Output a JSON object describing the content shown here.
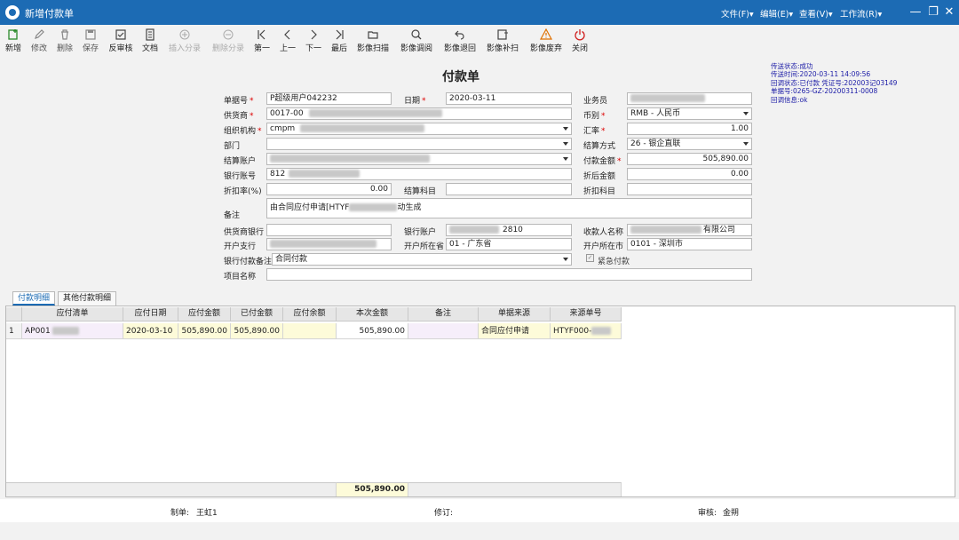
{
  "window": {
    "title": "新增付款单",
    "menus": [
      "文件(F)▾",
      "编辑(E)▾",
      "查看(V)▾",
      "工作流(R)▾"
    ]
  },
  "toolbar": [
    {
      "label": "新增",
      "icon": "new-doc-icon",
      "enabled": true
    },
    {
      "label": "修改",
      "icon": "edit-icon",
      "enabled": false
    },
    {
      "label": "删除",
      "icon": "trash-icon",
      "enabled": false
    },
    {
      "label": "保存",
      "icon": "save-icon",
      "enabled": false
    },
    {
      "label": "反审核",
      "icon": "unaudit-icon",
      "enabled": true
    },
    {
      "label": "文档",
      "icon": "document-icon",
      "enabled": true
    },
    {
      "label": "插入分录",
      "icon": "plus-circle-icon",
      "enabled": false
    },
    {
      "label": "删除分录",
      "icon": "minus-circle-icon",
      "enabled": false
    },
    {
      "label": "第一",
      "icon": "first-icon",
      "enabled": true
    },
    {
      "label": "上一",
      "icon": "prev-icon",
      "enabled": true
    },
    {
      "label": "下一",
      "icon": "next-icon",
      "enabled": true
    },
    {
      "label": "最后",
      "icon": "last-icon",
      "enabled": true
    },
    {
      "label": "影像扫描",
      "icon": "folder-icon",
      "enabled": true
    },
    {
      "label": "影像调阅",
      "icon": "search-icon",
      "enabled": true
    },
    {
      "label": "影像退回",
      "icon": "undo-icon",
      "enabled": true
    },
    {
      "label": "影像补扫",
      "icon": "rescan-icon",
      "enabled": true
    },
    {
      "label": "影像废弃",
      "icon": "warning-icon",
      "enabled": true
    },
    {
      "label": "关闭",
      "icon": "power-icon",
      "enabled": true
    }
  ],
  "doc_title": "付款单",
  "status_lines": [
    "传送状态:成功",
    "传送时间:2020-03-11 14:09:56",
    "回调状态:已付款  凭证号:202003记03149",
    "单据号:0265-GZ-20200311-0008",
    "回调信息:ok"
  ],
  "form": {
    "doc_no": {
      "label": "单据号",
      "value": "P超级用户042232"
    },
    "date": {
      "label": "日期",
      "value": "2020-03-11"
    },
    "salesman": {
      "label": "业务员",
      "value": ""
    },
    "supplier": {
      "label": "供货商",
      "value": "0017-00"
    },
    "currency": {
      "label": "币别",
      "value": "RMB - 人民币"
    },
    "org": {
      "label": "组织机构",
      "value": "cmpm"
    },
    "rate": {
      "label": "汇率",
      "value": "1.00"
    },
    "dept": {
      "label": "部门",
      "value": ""
    },
    "settle_method": {
      "label": "结算方式",
      "value": "26 - 银企直联"
    },
    "settle_account": {
      "label": "结算账户",
      "value": ""
    },
    "pay_amount": {
      "label": "付款金额",
      "value": "505,890.00"
    },
    "bank_account": {
      "label": "银行账号",
      "value": "812"
    },
    "after_discount": {
      "label": "折后金额",
      "value": "0.00"
    },
    "discount_rate": {
      "label": "折扣率(%)",
      "value": "0.00"
    },
    "settle_subject": {
      "label": "结算科目",
      "value": ""
    },
    "discount_subject": {
      "label": "折扣科目",
      "value": ""
    },
    "remark": {
      "label": "备注",
      "value_pre": "由合同应付申请[HTYF",
      "value_post": "动生成"
    },
    "supplier_bank": {
      "label": "供货商银行",
      "value": ""
    },
    "bank_acct2": {
      "label": "银行账户",
      "value": "2810"
    },
    "payee_name": {
      "label": "收款人名称",
      "value": "有限公司"
    },
    "branch": {
      "label": "开户支行",
      "value": ""
    },
    "province": {
      "label": "开户所在省",
      "value": "01 - 广东省"
    },
    "city": {
      "label": "开户所在市",
      "value": "0101 - 深圳市"
    },
    "bank_note": {
      "label": "银行付款备注",
      "value": "合同付款"
    },
    "urgent": {
      "label": "紧急付款",
      "checked": true
    },
    "project": {
      "label": "项目名称",
      "value": ""
    }
  },
  "tabs": [
    "付款明细",
    "其他付款明细"
  ],
  "grid": {
    "columns": [
      "应付清单",
      "应付日期",
      "应付金额",
      "已付金额",
      "应付余额",
      "本次金额",
      "备注",
      "单据来源",
      "来源单号"
    ],
    "rows": [
      {
        "no": "1",
        "cells": [
          "AP001",
          "2020-03-10",
          "505,890.00",
          "505,890.00",
          "",
          "505,890.00",
          "",
          "合同应付申请",
          "HTYF000-"
        ]
      }
    ],
    "total": "505,890.00"
  },
  "footer": {
    "maker_label": "制单:",
    "maker": "王虹1",
    "revise_label": "修订:",
    "revise": "",
    "audit_label": "审核:",
    "auditor": "金朔"
  }
}
